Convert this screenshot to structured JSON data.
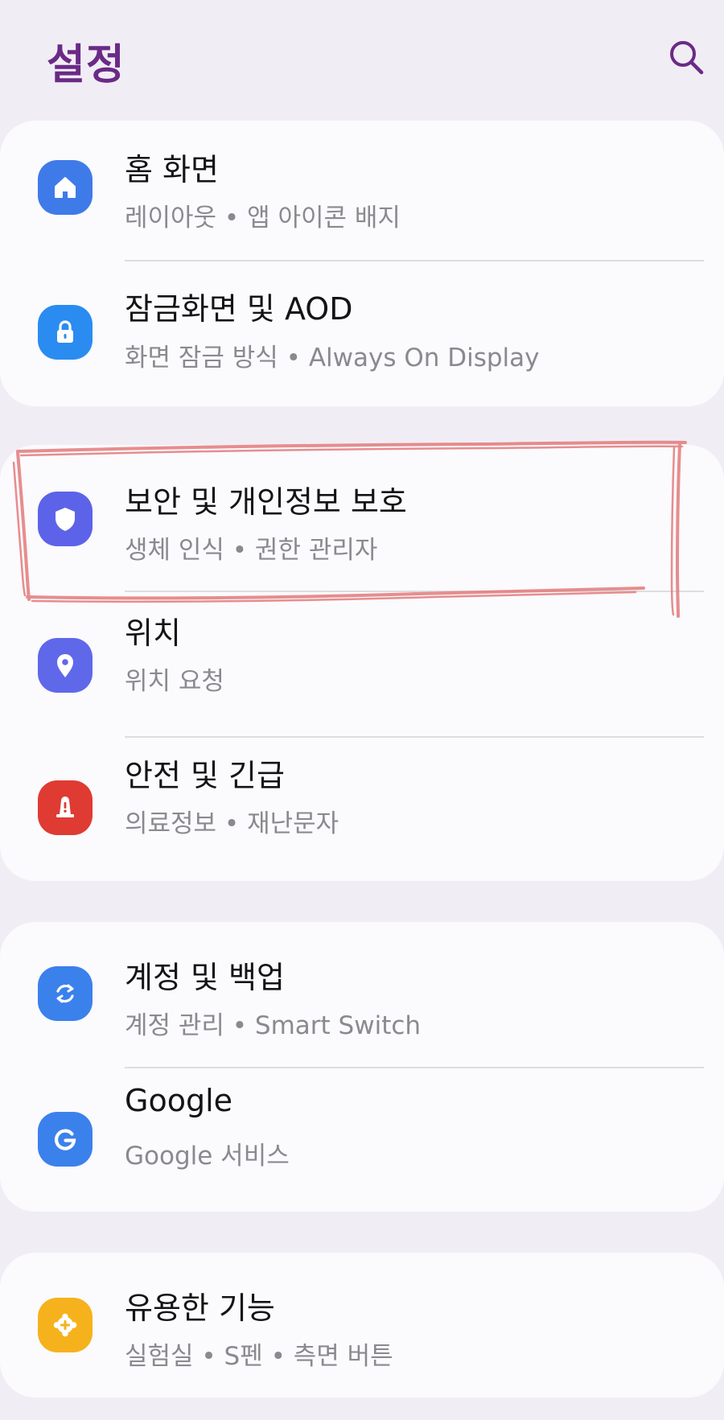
{
  "header": {
    "title": "설정",
    "search_icon": "search-icon"
  },
  "colors": {
    "title": "#6a2a86",
    "annotation": "#e37b7b",
    "home": "#3f7be8",
    "lock": "#2a8cf0",
    "security": "#5c63e8",
    "location": "#6068ea",
    "safety": "#df3b33",
    "accounts": "#3b81ec",
    "google": "#3b81ec",
    "advanced": "#f6b21c"
  },
  "groups": [
    {
      "items": [
        {
          "title": "홈 화면",
          "subtitle": "레이아웃  •  앱 아이콘 배지",
          "icon": "home-icon"
        },
        {
          "title": "잠금화면 및 AOD",
          "subtitle": "화면 잠금 방식  •  Always On Display",
          "icon": "lock-icon"
        }
      ]
    },
    {
      "items": [
        {
          "title": "보안 및 개인정보 보호",
          "subtitle": "생체 인식  •  권한 관리자",
          "icon": "shield-icon"
        },
        {
          "title": "위치",
          "subtitle": "위치 요청",
          "icon": "location-pin-icon"
        },
        {
          "title": "안전 및 긴급",
          "subtitle": "의료정보  •  재난문자",
          "icon": "alert-icon"
        }
      ]
    },
    {
      "items": [
        {
          "title": "계정 및 백업",
          "subtitle": "계정 관리  •  Smart Switch",
          "icon": "sync-icon"
        },
        {
          "title": "Google",
          "subtitle": "Google 서비스",
          "icon": "google-icon"
        }
      ]
    },
    {
      "items": [
        {
          "title": "유용한 기능",
          "subtitle": "실험실  •  S펜  •  측면 버튼",
          "icon": "puzzle-plus-icon"
        }
      ]
    }
  ]
}
